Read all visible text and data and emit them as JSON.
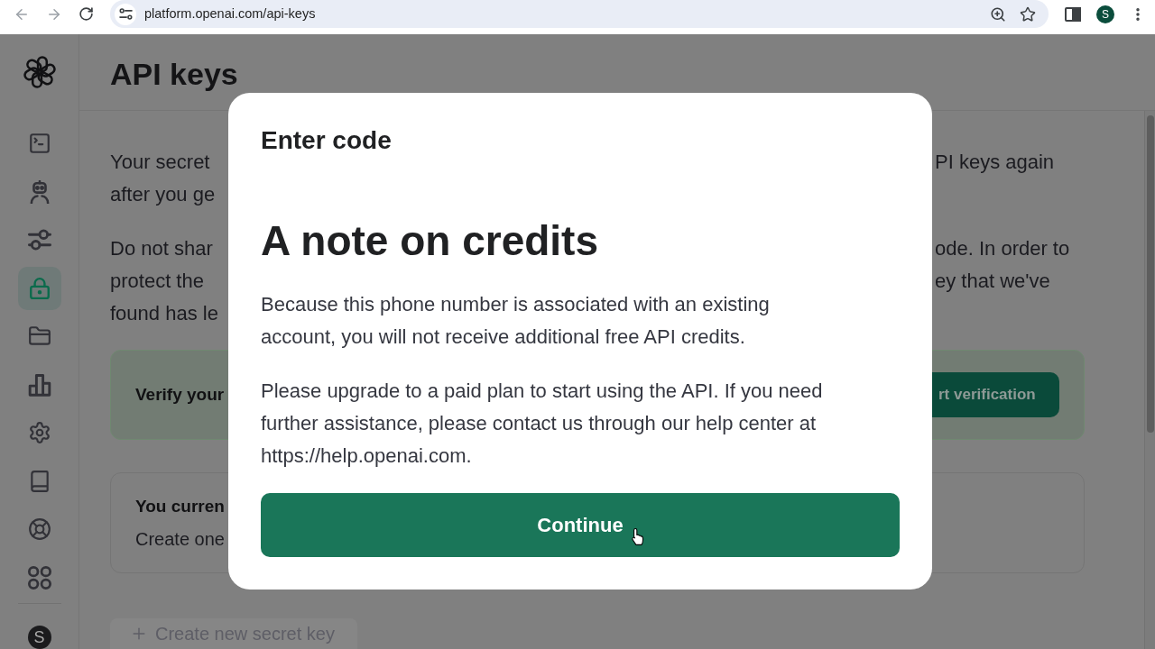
{
  "browser": {
    "url": "platform.openai.com/api-keys",
    "profile_initial": "S"
  },
  "sidebar": {
    "items": [
      {
        "selected": false
      },
      {
        "selected": false
      },
      {
        "selected": false
      },
      {
        "selected": true
      },
      {
        "selected": false
      },
      {
        "selected": false
      },
      {
        "selected": false
      },
      {
        "selected": false
      },
      {
        "selected": false
      },
      {
        "selected": false
      }
    ],
    "avatar_initial": "S"
  },
  "page": {
    "title": "API keys",
    "paragraphs": [
      {
        "lines": [
          {
            "left": "Your secret",
            "right": "PI keys again"
          },
          {
            "left": "after you ge"
          }
        ]
      },
      {
        "lines": [
          {
            "left": "Do not shar",
            "right": "ode. In order to"
          },
          {
            "left": "protect the",
            "right": "ey that we've"
          },
          {
            "left": "found has le"
          }
        ]
      }
    ],
    "verify_banner": {
      "text": "Verify your",
      "button": "rt verification"
    },
    "keys_card": {
      "title": "You curren",
      "text": "Create one"
    },
    "create_button": "Create new secret key"
  },
  "dialog": {
    "title": "Enter code",
    "heading": "A note on credits",
    "paragraphs": [
      "Because this phone number is associated with an existing account, you will not receive additional free API credits.",
      "Please upgrade to a paid plan to start using the API. If you need further assistance, please contact us through our help center at https://help.openai.com."
    ],
    "button": "Continue"
  }
}
